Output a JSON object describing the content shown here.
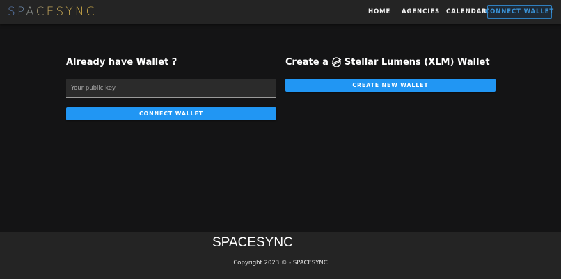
{
  "navbar": {
    "brand": "SPACESYNC",
    "links": [
      "HOME",
      "AGENCIES",
      "CALENDAR"
    ],
    "connect_label": "CONNECT WALLET"
  },
  "existing_wallet": {
    "title": "Already have Wallet ?",
    "input_placeholder": "Your public key",
    "input_value": "",
    "connect_label": "CONNECT WALLET"
  },
  "new_wallet": {
    "title_prefix": "Create a",
    "title_suffix": "Stellar Lumens (XLM) Wallet",
    "icon": "stellar-logo-icon",
    "create_label": "CREATE NEW WALLET"
  },
  "footer": {
    "brand": "SPACESYNC",
    "copyright": "Copyright 2023 © - SPACESYNC"
  },
  "colors": {
    "primary": "#2196f3",
    "background": "#141415",
    "bars": "#242424"
  }
}
